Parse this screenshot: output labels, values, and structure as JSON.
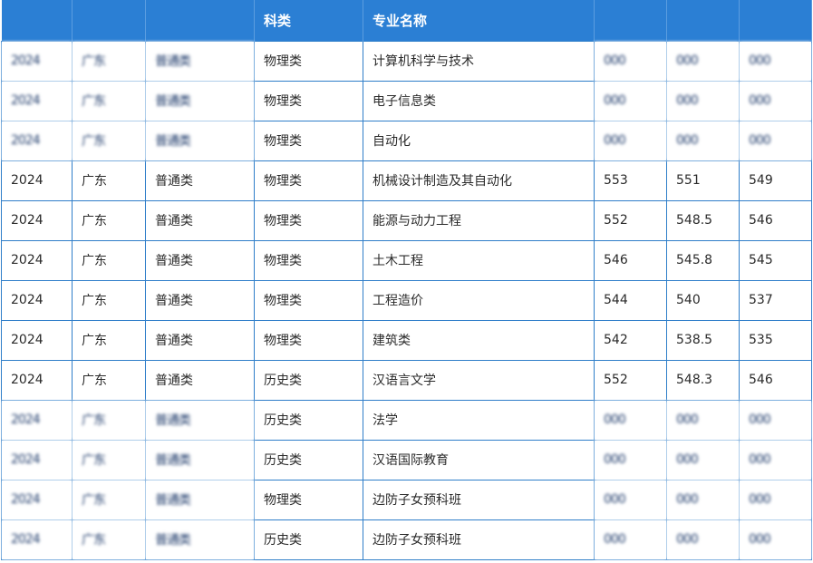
{
  "table": {
    "headers": [
      "",
      "",
      "",
      "科类",
      "专业名称",
      "",
      "",
      ""
    ],
    "rows": [
      [
        "2024",
        "广东",
        "普通类",
        "物理类",
        "计算机科学与技术",
        "",
        "",
        ""
      ],
      [
        "2024",
        "广东",
        "普通类",
        "物理类",
        "电子信息类",
        "",
        "",
        ""
      ],
      [
        "2024",
        "广东",
        "普通类",
        "物理类",
        "自动化",
        "",
        "",
        ""
      ],
      [
        "2024",
        "广东",
        "普通类",
        "物理类",
        "机械设计制造及其自动化",
        "553",
        "551",
        "549"
      ],
      [
        "2024",
        "广东",
        "普通类",
        "物理类",
        "能源与动力工程",
        "552",
        "548.5",
        "546"
      ],
      [
        "2024",
        "广东",
        "普通类",
        "物理类",
        "土木工程",
        "546",
        "545.8",
        "545"
      ],
      [
        "2024",
        "广东",
        "普通类",
        "物理类",
        "工程造价",
        "544",
        "540",
        "537"
      ],
      [
        "2024",
        "广东",
        "普通类",
        "物理类",
        "建筑类",
        "542",
        "538.5",
        "535"
      ],
      [
        "2024",
        "广东",
        "普通类",
        "历史类",
        "汉语言文学",
        "552",
        "548.3",
        "546"
      ],
      [
        "2024",
        "广东",
        "普通类",
        "历史类",
        "法学",
        "",
        "",
        ""
      ],
      [
        "2024",
        "广东",
        "普通类",
        "历史类",
        "汉语国际教育",
        "",
        "",
        ""
      ],
      [
        "2024",
        "广东",
        "普通类",
        "物理类",
        "边防子女预科班",
        "",
        "",
        ""
      ],
      [
        "2024",
        "广东",
        "普通类",
        "历史类",
        "边防子女预科班",
        "",
        "",
        ""
      ]
    ],
    "blurred_placeholders": {
      "year": "2024",
      "province": "广东",
      "type": "普通类",
      "score": "000"
    }
  },
  "colors": {
    "header_bg": "#2b7fd4",
    "header_text": "#ffffff",
    "border": "#2f7ec9",
    "cell_text": "#2a2a2a"
  }
}
